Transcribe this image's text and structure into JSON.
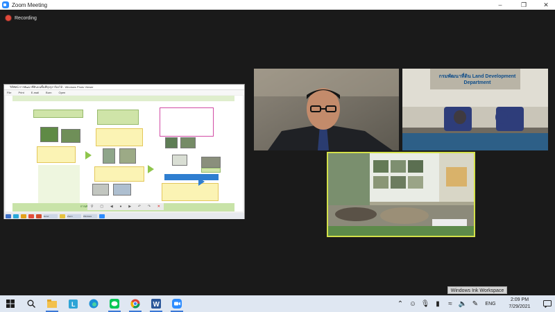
{
  "window": {
    "title": "Zoom Meeting",
    "controls": {
      "minimize": "–",
      "restore": "❐",
      "close": "✕"
    }
  },
  "recording": {
    "label": "Recording",
    "color": "#e0483a"
  },
  "share": {
    "viewer_title": "วิดีทัศน์ การพัฒนาที่ดินบนพื้นที่ทุ่งกุลาร้องไห้ - Windows Photo Viewer",
    "menu": [
      "File",
      "Print",
      "E-mail",
      "Burn",
      "Open"
    ],
    "slide": {
      "bottom_text": "การเพิ่มศักยภาพการผลิตทุ่งกุลาร้องไห้ (กลางน้ำ - ปลายน้ำ)"
    },
    "taskbar_items": [
      "Edge",
      "Chrome",
      "Explorer",
      "Word",
      "Excel",
      "Powerpoint",
      "Zoom",
      "Windows"
    ]
  },
  "videos": [
    {
      "name": "speaker",
      "active": false
    },
    {
      "name": "meeting-room",
      "banner": "กรมพัฒนาที่ดิน Land Development Department",
      "active": false
    },
    {
      "name": "exhibition",
      "active": true,
      "highlight": "#d4e14a"
    }
  ],
  "ink_workspace": {
    "label": "Windows Ink Workspace"
  },
  "taskbar": {
    "apps": [
      "start",
      "search",
      "file-explorer",
      "lightbox",
      "edge",
      "line",
      "chrome",
      "word",
      "zoom"
    ],
    "active_apps": [
      "file-explorer",
      "line",
      "chrome",
      "word",
      "zoom"
    ],
    "lang": "ENG",
    "time": "2:09 PM",
    "date": "7/29/2021"
  },
  "colors": {
    "accent": "#2d8cff",
    "taskbar": "#dfe7f2",
    "background": "#1a1a1a"
  }
}
